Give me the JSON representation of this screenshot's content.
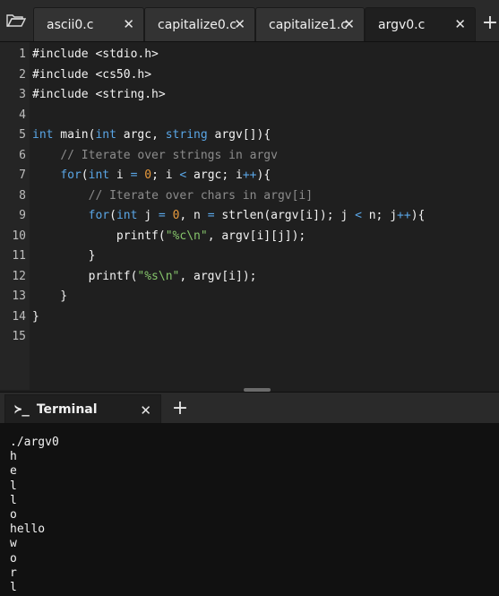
{
  "editor_tabs": [
    {
      "label": "ascii0.c",
      "active": false
    },
    {
      "label": "capitalize0.c",
      "active": false
    },
    {
      "label": "capitalize1.c",
      "active": false
    },
    {
      "label": "argv0.c",
      "active": true
    }
  ],
  "icons": {
    "folder": "folder-open-icon",
    "close": "close-icon",
    "add": "plus-icon",
    "terminal": "terminal-prompt-icon"
  },
  "glyphs": {
    "close": "✕",
    "plus": "+",
    "prompt": "≻_"
  },
  "code_lines": [
    {
      "n": "1",
      "text": "#include <stdio.h>"
    },
    {
      "n": "2",
      "text": "#include <cs50.h>"
    },
    {
      "n": "3",
      "text": "#include <string.h>"
    },
    {
      "n": "4",
      "text": ""
    },
    {
      "n": "5",
      "text": "int main(int argc, string argv[]){"
    },
    {
      "n": "6",
      "text": "    // Iterate over strings in argv"
    },
    {
      "n": "7",
      "text": "    for(int i = 0; i < argc; i++){"
    },
    {
      "n": "8",
      "text": "        // Iterate over chars in argv[i]"
    },
    {
      "n": "9",
      "text": "        for(int j = 0, n = strlen(argv[i]); j < n; j++){"
    },
    {
      "n": "10",
      "text": "            printf(\"%c\\n\", argv[i][j]);"
    },
    {
      "n": "11",
      "text": "        }"
    },
    {
      "n": "12",
      "text": "        printf(\"%s\\n\", argv[i]);"
    },
    {
      "n": "13",
      "text": "    }"
    },
    {
      "n": "14",
      "text": "}"
    },
    {
      "n": "15",
      "text": ""
    }
  ],
  "terminal": {
    "tab_label": "Terminal",
    "output": [
      "./argv0",
      "h",
      "e",
      "l",
      "l",
      "o",
      "hello",
      "w",
      "o",
      "r",
      "l"
    ]
  },
  "colors": {
    "keyword": "#5aa6e6",
    "comment": "#8c8c8c",
    "string": "#86c56b",
    "number": "#e89a3c",
    "background": "#1f1f1f"
  }
}
